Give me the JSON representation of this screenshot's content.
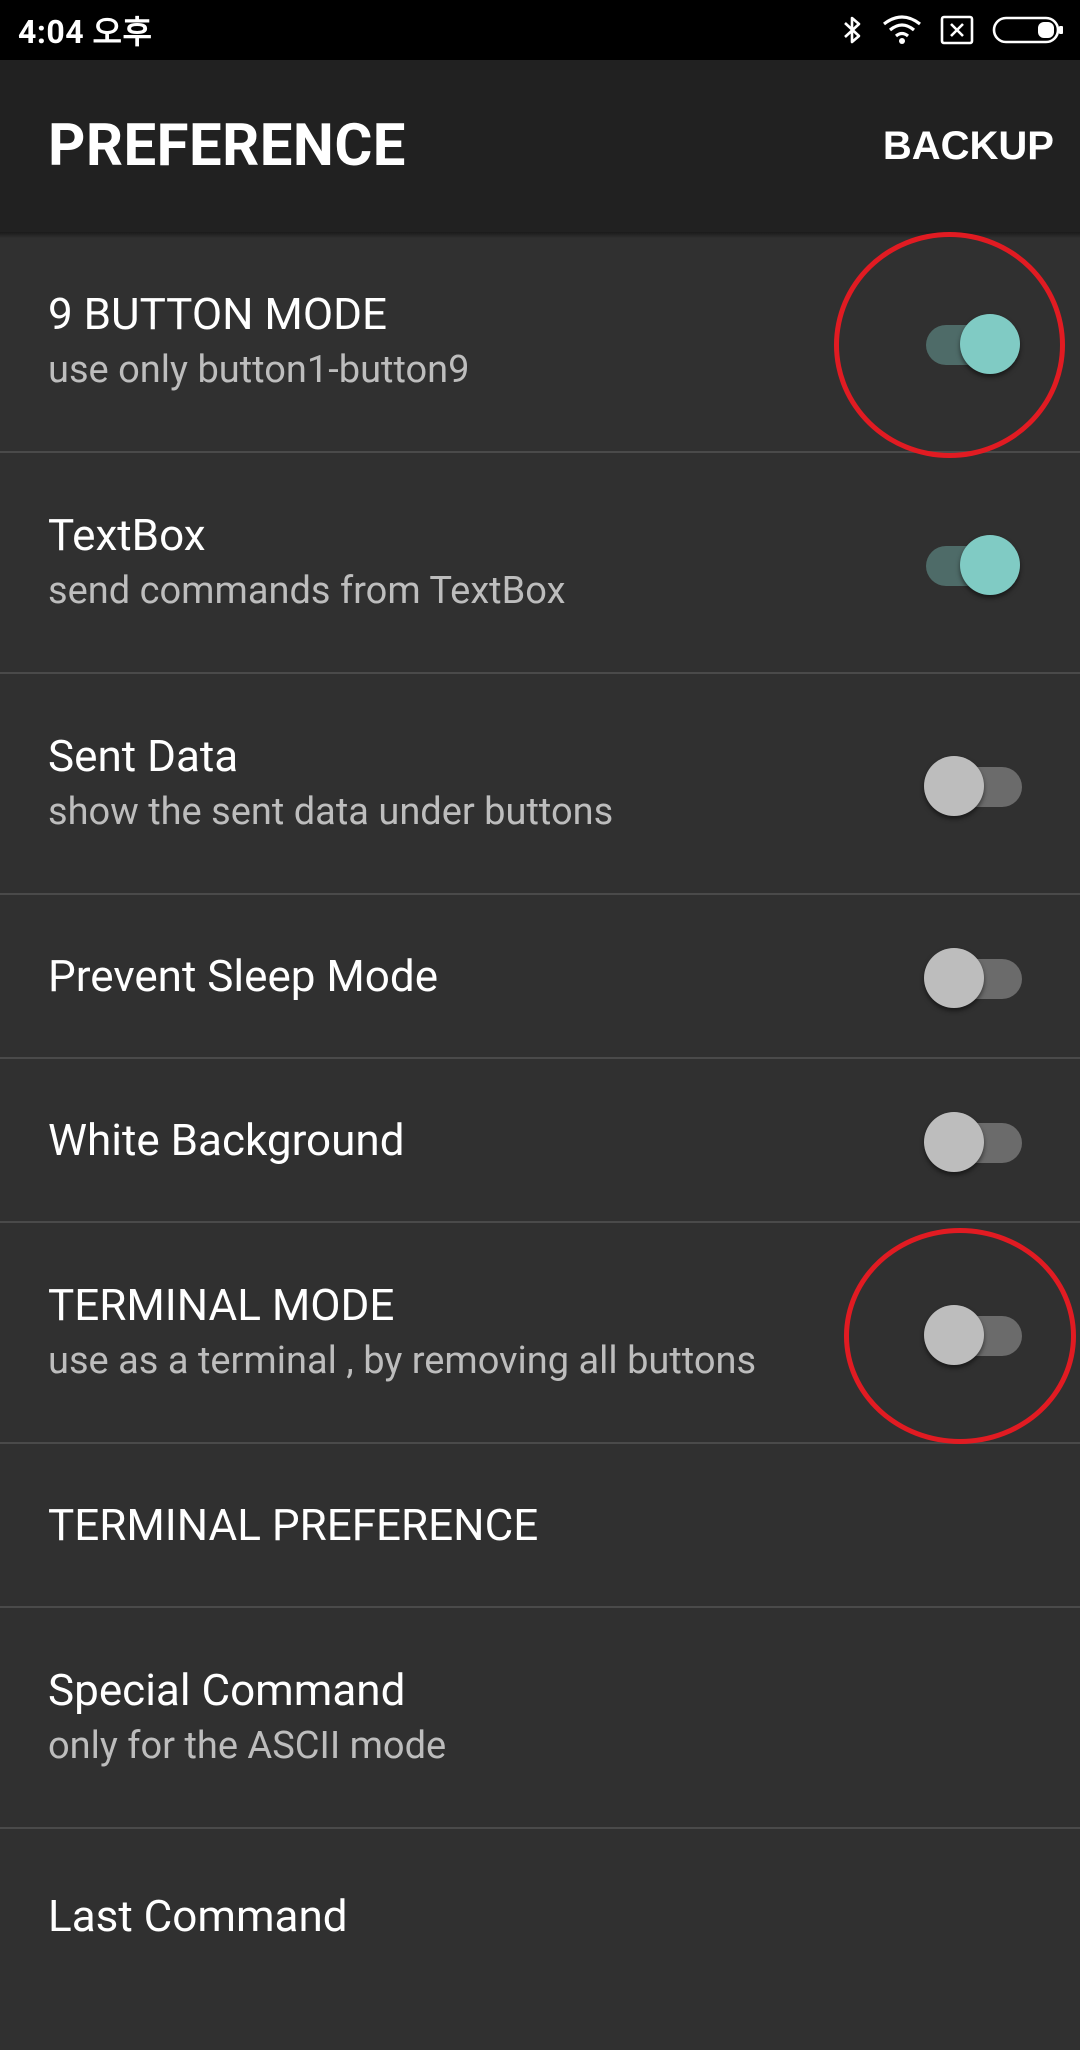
{
  "status_bar": {
    "time": "4:04 오후",
    "icons": [
      "bluetooth-icon",
      "wifi-icon",
      "no-sim-icon",
      "battery-icon"
    ]
  },
  "app_bar": {
    "title": "PREFERENCE",
    "backup_label": "BACKUP"
  },
  "preferences": [
    {
      "title": "9 BUTTON MODE",
      "summary": "use only button1-button9",
      "switch": "on"
    },
    {
      "title": "TextBox",
      "summary": "send commands from TextBox",
      "switch": "on"
    },
    {
      "title": "Sent Data",
      "summary": "show the sent data under buttons",
      "switch": "off"
    },
    {
      "title": "Prevent Sleep Mode",
      "switch": "off"
    },
    {
      "title": "White Background",
      "switch": "off"
    },
    {
      "title": "TERMINAL MODE",
      "summary": "use as a terminal , by removing all buttons",
      "switch": "off"
    },
    {
      "title": "TERMINAL PREFERENCE"
    },
    {
      "title": "Special Command",
      "summary": "only for the ASCII mode"
    },
    {
      "title": "Last Command"
    }
  ],
  "colors": {
    "background": "#303030",
    "app_bar": "#212121",
    "switch_on_thumb": "#80cbc4",
    "switch_on_track": "#4e6b68",
    "switch_off_thumb": "#bdbdbd",
    "switch_off_track": "#6b6b6b",
    "annotation": "#e11b22"
  }
}
